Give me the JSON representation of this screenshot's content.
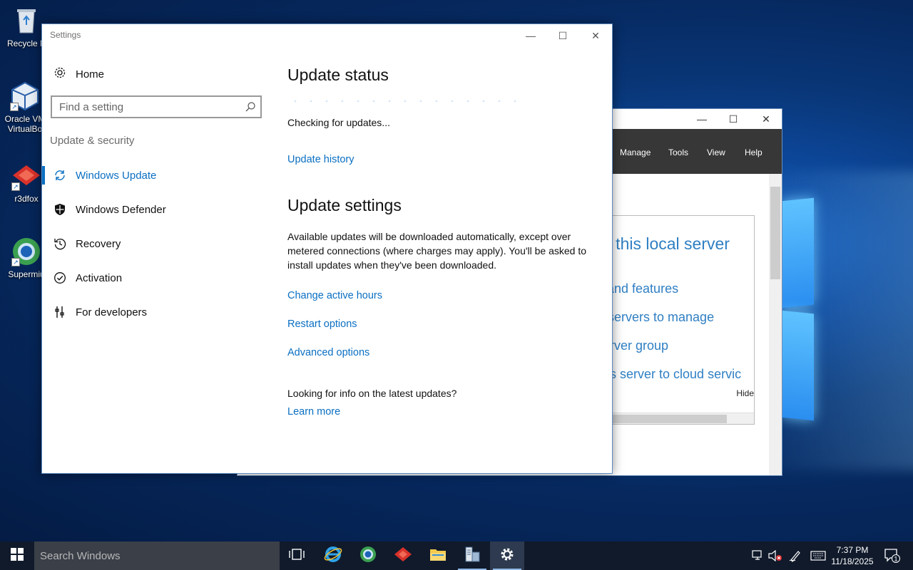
{
  "desktop": {
    "icons": [
      {
        "label": "Recycle Bin",
        "icon": "recycle-bin-icon"
      },
      {
        "label": "Oracle VM VirtualBox",
        "icon": "virtualbox-icon"
      },
      {
        "label": "r3dfox",
        "icon": "r3dfox-icon"
      },
      {
        "label": "Supermium",
        "icon": "supermium-icon"
      }
    ],
    "icon_texts": {
      "recycle": "Recycle B",
      "oracle_1": "Oracle VM",
      "oracle_2": "VirtualBo",
      "r3dfox": "r3dfox",
      "supermium": "Supermiu"
    }
  },
  "server_manager": {
    "menu": [
      "Manage",
      "Tools",
      "View",
      "Help"
    ],
    "panel_title": "e this local server",
    "panel_links": [
      "s and features",
      "er servers to manage",
      "server group",
      "this server to cloud servic"
    ],
    "hide_label": "Hide"
  },
  "settings": {
    "window_title": "Settings",
    "home_label": "Home",
    "search_placeholder": "Find a setting",
    "section_label": "Update & security",
    "nav_items": [
      {
        "label": "Windows Update",
        "icon": "sync-icon",
        "active": true
      },
      {
        "label": "Windows Defender",
        "icon": "shield-icon",
        "active": false
      },
      {
        "label": "Recovery",
        "icon": "history-icon",
        "active": false
      },
      {
        "label": "Activation",
        "icon": "check-circle-icon",
        "active": false
      },
      {
        "label": "For developers",
        "icon": "developer-tools-icon",
        "active": false
      }
    ],
    "update_status": {
      "heading": "Update status",
      "status_text": "Checking for updates...",
      "history_link": "Update history"
    },
    "update_settings": {
      "heading": "Update settings",
      "description": "Available updates will be downloaded automatically, except over metered connections (where charges may apply). You'll be asked to install updates when they've been downloaded.",
      "links": [
        "Change active hours",
        "Restart options",
        "Advanced options"
      ]
    },
    "info": {
      "question": "Looking for info on the latest updates?",
      "learn_more": "Learn more"
    }
  },
  "taskbar": {
    "search_placeholder": "Search Windows",
    "apps": [
      "task-view",
      "internet-explorer",
      "supermium",
      "r3dfox",
      "file-explorer",
      "server-manager",
      "settings"
    ],
    "clock_time": "7:37 PM",
    "clock_date": "11/18/2025",
    "notification_count": "1"
  },
  "colors": {
    "accent": "#0a6fc2",
    "desktop_bg": "#062a5c",
    "taskbar_bg": "#101a2b"
  }
}
